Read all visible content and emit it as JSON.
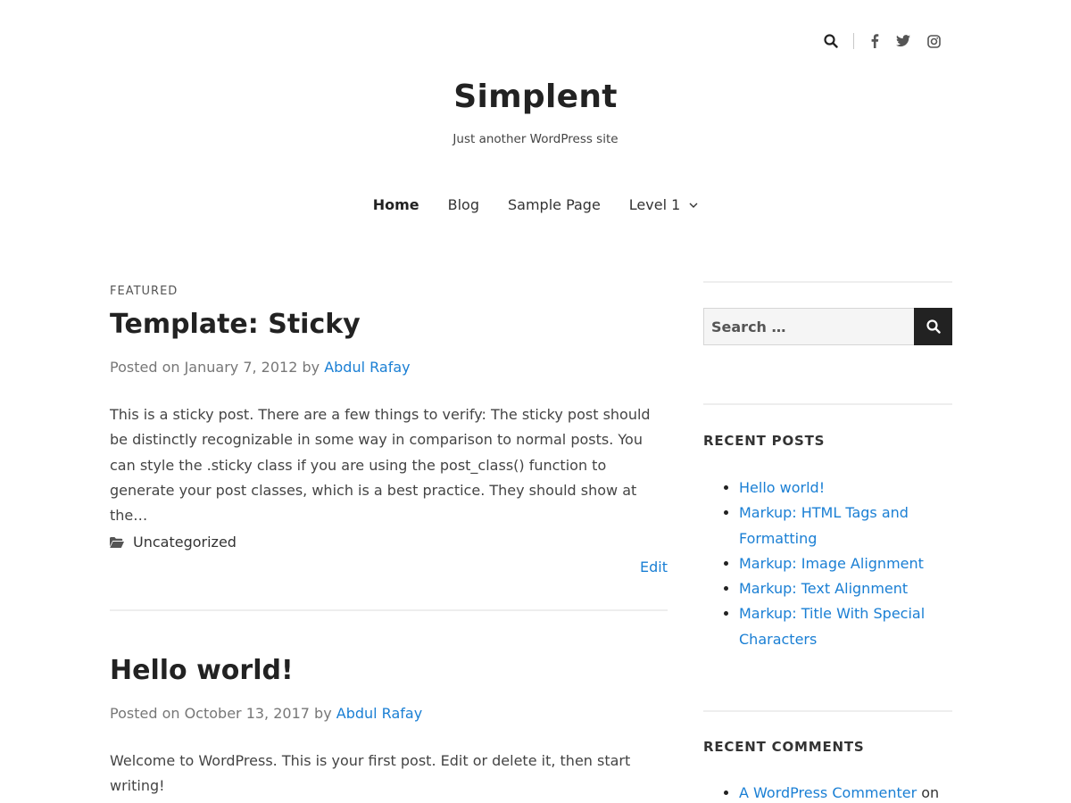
{
  "social": {
    "search_icon": "search-icon",
    "facebook_icon": "facebook-icon",
    "twitter_icon": "twitter-icon",
    "instagram_icon": "instagram-icon"
  },
  "site": {
    "title": "Simplent",
    "description": "Just another WordPress site"
  },
  "nav": {
    "items": [
      {
        "label": "Home",
        "active": true
      },
      {
        "label": "Blog"
      },
      {
        "label": "Sample Page"
      },
      {
        "label": "Level 1",
        "has_submenu": true
      }
    ]
  },
  "posts": [
    {
      "kicker": "FEATURED",
      "title": "Template: Sticky",
      "meta_prefix": "Posted on January 7, 2012 by ",
      "author": "Abdul Rafay",
      "excerpt": "This is a sticky post. There are a few things to verify: The sticky post should be distinctly recognizable in some way in comparison to normal posts. You can style the .sticky class if you are using the post_class() function to generate your post classes, which is a best practice. They should show at the…",
      "category": "Uncategorized",
      "edit_label": "Edit"
    },
    {
      "title": "Hello world!",
      "meta_prefix": "Posted on October 13, 2017 by ",
      "author": "Abdul Rafay",
      "excerpt": "Welcome to WordPress. This is your first post. Edit or delete it, then start writing!"
    }
  ],
  "sidebar": {
    "search_placeholder": "Search …",
    "recent_posts": {
      "title": "RECENT POSTS",
      "items": [
        "Hello world!",
        "Markup: HTML Tags and Formatting",
        "Markup: Image Alignment",
        "Markup: Text Alignment",
        "Markup: Title With Special Characters"
      ]
    },
    "recent_comments": {
      "title": "RECENT COMMENTS",
      "items": [
        {
          "author": "A WordPress Commenter",
          "suffix": " on"
        }
      ]
    }
  },
  "colors": {
    "link": "#1a7fd4",
    "text": "#222222",
    "meta": "#777777",
    "button": "#222222"
  }
}
